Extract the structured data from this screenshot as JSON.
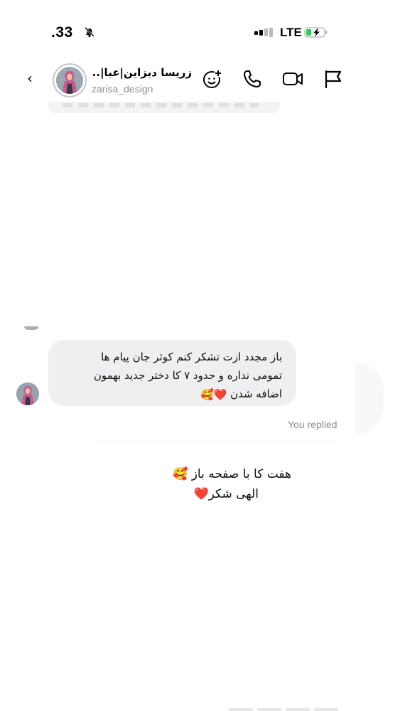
{
  "status_bar": {
    "time": ".33",
    "network": "LTE"
  },
  "header": {
    "contact_name": "زریسا دیزاین|عبا|...",
    "contact_handle": "zarisa_design",
    "icons": [
      "chevron-left-icon",
      "add-emoji-icon",
      "phone-icon",
      "video-icon",
      "flag-icon"
    ]
  },
  "messages": {
    "received": {
      "lines": [
        "باز مجدد ازت تشکر کنم کوثر جان پیام ها",
        "تمومی نداره و حدود ۷ کا دختر جدید بهمون",
        "اضافه شدن"
      ],
      "emojis": "❤️🥰"
    },
    "replied_label": "You replied",
    "reply": {
      "line1": "هفت کا با صفحه باز",
      "line1_emoji": "🥰",
      "line2": "الهی شکر",
      "line2_emoji": "❤️"
    }
  },
  "colors": {
    "bubble_bg": "#efeff2",
    "heart": "#e0262f",
    "battery_charge": "#34c759",
    "muted_text": "#8e8e8e"
  }
}
